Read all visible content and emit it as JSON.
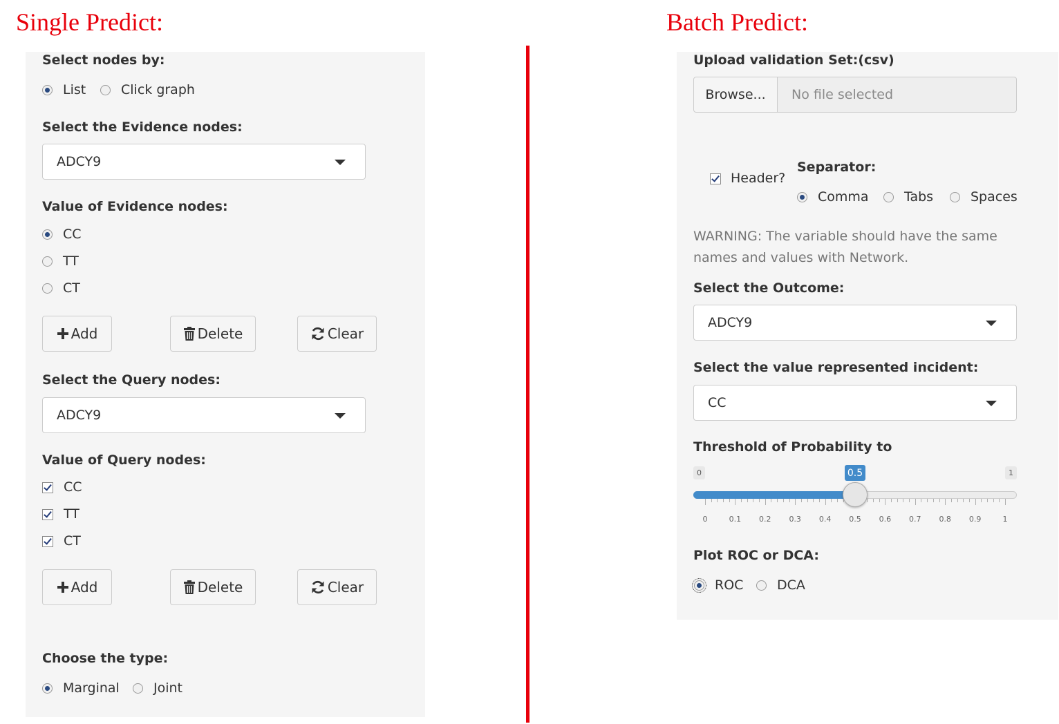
{
  "single": {
    "title": "Single Predict:",
    "select_by": {
      "label": "Select nodes by:",
      "options": [
        "List",
        "Click graph"
      ],
      "selected": "List"
    },
    "evidence": {
      "label": "Select the Evidence nodes:",
      "value": "ADCY9",
      "values_label": "Value of Evidence nodes:",
      "values": [
        "CC",
        "TT",
        "CT"
      ],
      "selected": "CC"
    },
    "query": {
      "label": "Select the Query nodes:",
      "value": "ADCY9",
      "values_label": "Value of Query nodes:",
      "values": [
        "CC",
        "TT",
        "CT"
      ],
      "checked": [
        "CC",
        "TT",
        "CT"
      ]
    },
    "buttons": {
      "add": "Add",
      "delete": "Delete",
      "clear": "Clear"
    },
    "type": {
      "label": "Choose the type:",
      "options": [
        "Marginal",
        "Joint"
      ],
      "selected": "Marginal"
    }
  },
  "batch": {
    "title": "Batch Predict:",
    "upload": {
      "label": "Upload validation Set:(csv)",
      "browse": "Browse...",
      "placeholder": "No file selected"
    },
    "header": {
      "label": "Header?",
      "checked": true
    },
    "separator": {
      "label": "Separator:",
      "options": [
        "Comma",
        "Tabs",
        "Spaces"
      ],
      "selected": "Comma"
    },
    "warning": "WARNING: The variable should have the same names and values with Network.",
    "outcome": {
      "label": "Select the Outcome:",
      "value": "ADCY9"
    },
    "incident": {
      "label": "Select the value represented incident:",
      "value": "CC"
    },
    "threshold": {
      "label": "Threshold of Probability to",
      "min": 0,
      "max": 1,
      "value": 0.5,
      "min_label": "0",
      "max_label": "1",
      "value_label": "0.5",
      "tick_labels": [
        "0",
        "0.1",
        "0.2",
        "0.3",
        "0.4",
        "0.5",
        "0.6",
        "0.7",
        "0.8",
        "0.9",
        "1"
      ]
    },
    "plot": {
      "label": "Plot ROC or DCA:",
      "options": [
        "ROC",
        "DCA"
      ],
      "selected": "ROC"
    }
  }
}
